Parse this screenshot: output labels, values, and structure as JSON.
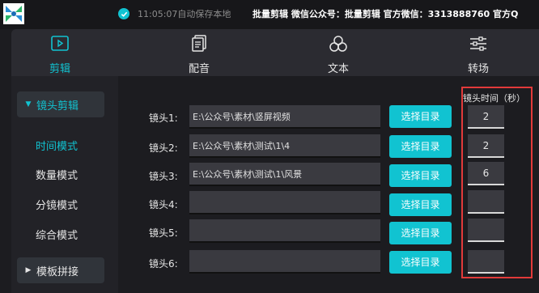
{
  "titlebar": {
    "save_status": "11:05:07自动保存本地",
    "brand_text": "批量剪辑  微信公众号：批量剪辑  官方微信：3313888760  官方Q"
  },
  "tabs": [
    {
      "label": "剪辑",
      "icon": "play-box-icon",
      "active": true
    },
    {
      "label": "配音",
      "icon": "copy-document-icon",
      "active": false
    },
    {
      "label": "文本",
      "icon": "circles-icon",
      "active": false
    },
    {
      "label": "转场",
      "icon": "sliders-icon",
      "active": false
    }
  ],
  "sidebar": {
    "group_open": "镜头剪辑",
    "modes": [
      "时间模式",
      "数量模式",
      "分镜模式",
      "综合模式"
    ],
    "group_closed": "模板拼接"
  },
  "main": {
    "duration_header": "镜头时间（秒）",
    "browse_label": "选择目录",
    "rows": [
      {
        "label": "镜头1:",
        "path": "E:\\公众号\\素材\\竖屏视频",
        "duration": "2"
      },
      {
        "label": "镜头2:",
        "path": "E:\\公众号\\素材\\测试\\1\\4",
        "duration": "2"
      },
      {
        "label": "镜头3:",
        "path": "E:\\公众号\\素材\\测试\\1\\风景",
        "duration": "6"
      },
      {
        "label": "镜头4:",
        "path": "",
        "duration": ""
      },
      {
        "label": "镜头5:",
        "path": "",
        "duration": ""
      },
      {
        "label": "镜头6:",
        "path": "",
        "duration": ""
      }
    ]
  },
  "colors": {
    "accent": "#11c3d1",
    "highlight": "#e23a3a",
    "background": "#1c1c20"
  }
}
